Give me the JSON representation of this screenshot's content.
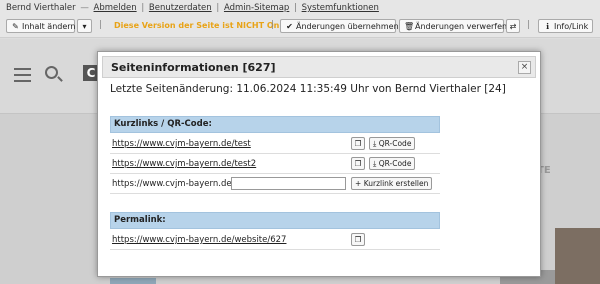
{
  "topbar": {
    "user": "Bernd Vierthaler",
    "dash": "—",
    "links": [
      "Abmelden",
      "Benutzerdaten",
      "Admin-Sitemap",
      "Systemfunktionen"
    ],
    "edit_content_label": "Inhalt ändern",
    "warning": "Diese Version der Seite ist NICHT Online!",
    "apply_label": "Änderungen übernehmen",
    "discard_label": "Änderungen verwerfen",
    "info_label": "Info/Link"
  },
  "background": {
    "logo_letter": "C",
    "partial_text": "TE"
  },
  "modal": {
    "title": "Seiteninformationen [627]",
    "close_symbol": "×",
    "last_change": "Letzte Seitenänderung: 11.06.2024 11:35:49 Uhr von Bernd Vierthaler [24]",
    "shortlinks": {
      "heading": "Kurzlinks / QR-Code:",
      "links": [
        "https://www.cvjm-bayern.de/test",
        "https://www.cvjm-bayern.de/test2"
      ],
      "qr_label": "QR-Code",
      "new_prefix": "https://www.cvjm-bayern.de/",
      "new_value": "",
      "create_label": "Kurzlink erstellen"
    },
    "permalink": {
      "heading": "Permalink:",
      "url": "https://www.cvjm-bayern.de/website/627"
    }
  },
  "colors": {
    "warning": "#e8a317",
    "section_header": "#b7d3ea"
  }
}
